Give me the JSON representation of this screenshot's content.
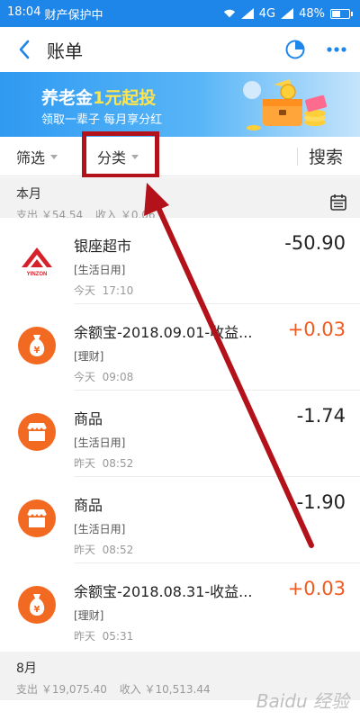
{
  "status_bar": {
    "time": "18:04",
    "notice": "财产保护中",
    "network": "4G",
    "battery_percent": "48%",
    "battery_level": 0.48
  },
  "nav": {
    "title": "账单",
    "back_icon": "chevron-left-icon",
    "chart_icon": "pie-chart-icon",
    "more_icon": "more-dots-icon"
  },
  "banner": {
    "title_prefix": "养老金",
    "title_highlight": "1元起投",
    "subtitle": "领取一辈子 每月享分红"
  },
  "filters": {
    "filter_label": "筛选",
    "category_label": "分类",
    "search_label": "搜索"
  },
  "months": [
    {
      "name": "本月",
      "expense": "支出 ￥54.54",
      "income": "收入 ￥0.06"
    },
    {
      "name": "8月",
      "expense": "支出 ￥19,075.40",
      "income": "收入 ￥10,513.44"
    }
  ],
  "transactions": [
    {
      "title": "银座超市",
      "category": "[生活日用]",
      "day": "今天",
      "time": "17:10",
      "amount": "-50.90",
      "positive": false,
      "icon": "yinzuo-logo-icon"
    },
    {
      "title": "余额宝-2018.09.01-收益...",
      "category": "[理财]",
      "day": "今天",
      "time": "09:08",
      "amount": "+0.03",
      "positive": true,
      "icon": "money-bag-icon"
    },
    {
      "title": "商品",
      "category": "[生活日用]",
      "day": "昨天",
      "time": "08:52",
      "amount": "-1.74",
      "positive": false,
      "icon": "store-icon"
    },
    {
      "title": "商品",
      "category": "[生活日用]",
      "day": "昨天",
      "time": "08:52",
      "amount": "-1.90",
      "positive": false,
      "icon": "store-icon"
    },
    {
      "title": "余额宝-2018.08.31-收益...",
      "category": "[理财]",
      "day": "昨天",
      "time": "05:31",
      "amount": "+0.03",
      "positive": true,
      "icon": "money-bag-icon"
    }
  ],
  "colors": {
    "brand_blue": "#1e86e8",
    "positive_amount": "#f05a1e",
    "highlight_red": "#b3121a"
  },
  "watermark": "Baidu 经验"
}
